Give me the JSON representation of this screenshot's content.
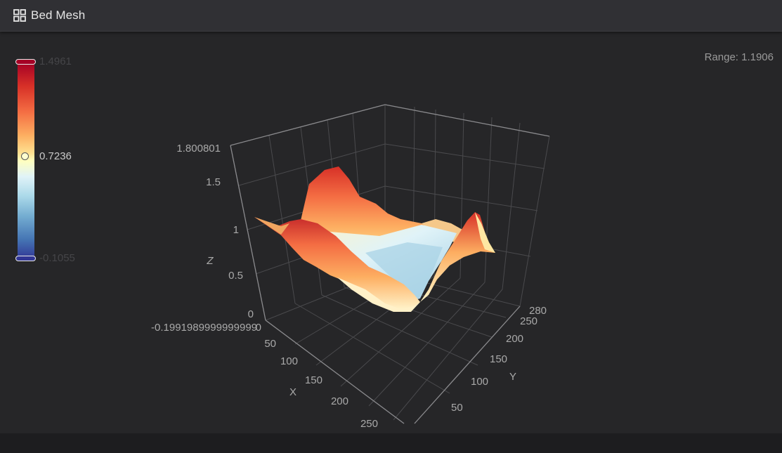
{
  "header": {
    "title": "Bed Mesh",
    "icon": "grid-icon"
  },
  "range": {
    "label": "Range: 1.1906"
  },
  "colorbar": {
    "max_label": "1.4961",
    "mid_label": "0.7236",
    "min_label": "-0.1055",
    "colorscale": [
      "#a50026",
      "#d73027",
      "#f46d43",
      "#fdae61",
      "#fee090",
      "#ffffbf",
      "#e0f3f8",
      "#abd9e9",
      "#74add1",
      "#4575b4",
      "#313695"
    ]
  },
  "chart_data": {
    "type": "surface",
    "title": "",
    "xlabel": "X",
    "ylabel": "Y",
    "zlabel": "Z",
    "x_ticks": [
      "0",
      "50",
      "100",
      "150",
      "200",
      "250"
    ],
    "y_ticks": [
      "50",
      "100",
      "150",
      "200",
      "250",
      "280"
    ],
    "z_ticks": [
      "-0.1991989999999999",
      "0",
      "0.5",
      "1",
      "1.5",
      "1.800801"
    ],
    "z_range": [
      -0.199199,
      1.800801
    ],
    "value_range": [
      -0.1055,
      1.4961
    ],
    "grid": true
  }
}
